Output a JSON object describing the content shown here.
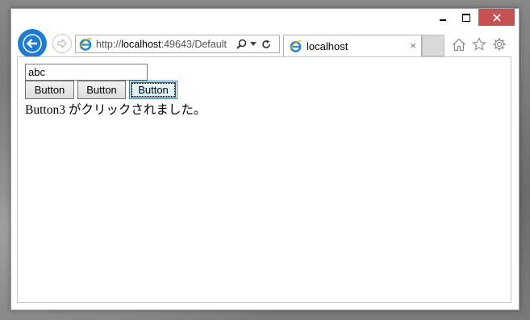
{
  "window": {
    "caption_close_color": "#c75050"
  },
  "navigation": {
    "back_icon": "back-arrow-icon",
    "forward_icon": "forward-arrow-icon",
    "address": {
      "url_prefix": "http://",
      "url_host": "localhost",
      "url_rest": ":49643/Default",
      "search_icon": "search-icon",
      "dropdown_icon": "chevron-down-icon",
      "refresh_icon": "refresh-icon"
    },
    "tab": {
      "label": "localhost",
      "close_glyph": "×"
    },
    "toolbar_icons": [
      "home-icon",
      "star-icon",
      "gear-icon"
    ]
  },
  "page": {
    "input_value": "abc",
    "buttons": [
      {
        "label": "Button"
      },
      {
        "label": "Button"
      },
      {
        "label": "Button"
      }
    ],
    "message": "Button3 がクリックされました。"
  },
  "colors": {
    "back_button": "#1e7bd4",
    "ie_logo": "#1e88d4"
  }
}
